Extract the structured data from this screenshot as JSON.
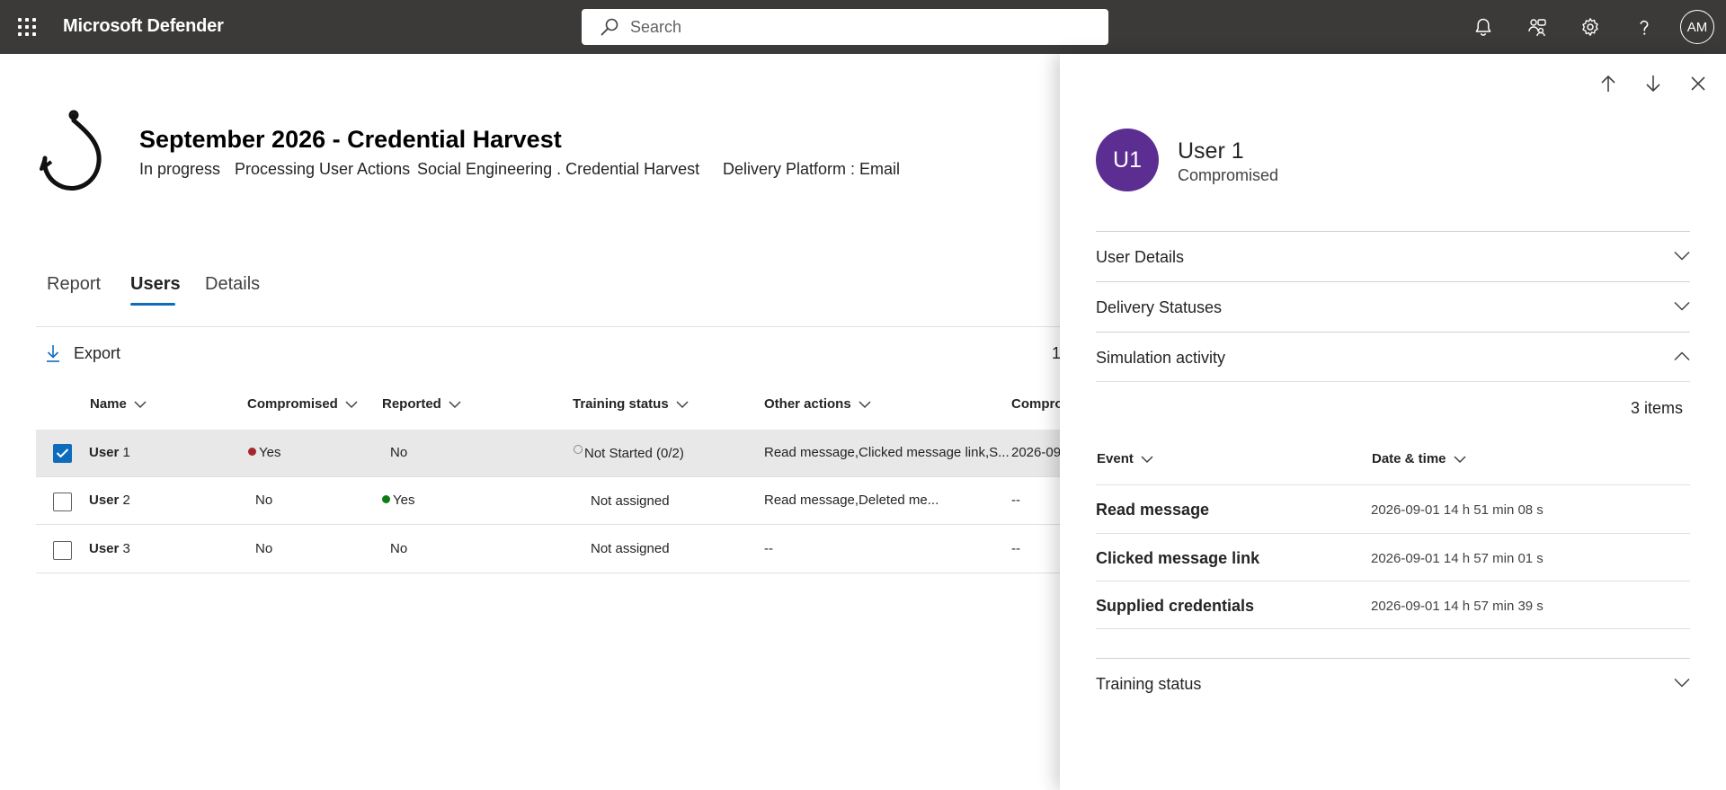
{
  "topbar": {
    "app_title": "Microsoft Defender",
    "search_placeholder": "Search",
    "avatar_initials": "AM",
    "icons": [
      "waffle-icon",
      "search-icon",
      "bell-icon",
      "community-icon",
      "gear-icon",
      "help-icon"
    ]
  },
  "simulation": {
    "title": "September 2026 - Credential Harvest",
    "status": "In progress",
    "phase": "Processing User Actions",
    "technique": "Social Engineering . Credential Harvest",
    "platform": "Delivery Platform : Email"
  },
  "tabs": [
    {
      "label": "Report",
      "active": false
    },
    {
      "label": "Users",
      "active": true
    },
    {
      "label": "Details",
      "active": false
    }
  ],
  "toolbar": {
    "export_label": "Export",
    "count_stub": "1"
  },
  "table": {
    "columns": [
      "Name",
      "Compromised",
      "Reported",
      "Training status",
      "Other actions",
      "Compro"
    ],
    "rows": [
      {
        "selected": true,
        "name_bold": "User",
        "name_num": " 1",
        "compromised": "Yes",
        "compromised_dot": "#a4262c",
        "reported": "No",
        "training": "Not Started (0/2)",
        "other": "Read message,Clicked message link,S...",
        "compromised_date": "2026-09"
      },
      {
        "selected": false,
        "name_bold": "User",
        "name_num": " 2",
        "compromised": "No",
        "reported": "Yes",
        "reported_dot": "#107c10",
        "training": "Not assigned",
        "other": "Read message,Deleted me...",
        "compromised_date": "--"
      },
      {
        "selected": false,
        "name_bold": "User",
        "name_num": " 3",
        "compromised": "No",
        "reported": "No",
        "training": "Not assigned",
        "other": "--",
        "compromised_date": "--"
      }
    ]
  },
  "panel": {
    "avatar_initials": "U1",
    "avatar_color": "#5c2e91",
    "user_name": "User 1",
    "user_status": "Compromised",
    "sections": {
      "user_details": "User Details",
      "delivery_statuses": "Delivery Statuses",
      "simulation_activity": "Simulation activity",
      "training_status": "Training status"
    },
    "items_count": "3 items",
    "activity_columns": [
      "Event",
      "Date & time"
    ],
    "activity": [
      {
        "event": "Read message",
        "datetime": "2026-09-01 14 h 51 min 08 s"
      },
      {
        "event": "Clicked message link",
        "datetime": "2026-09-01 14 h 57 min 01 s"
      },
      {
        "event": "Supplied credentials",
        "datetime": "2026-09-01 14 h 57 min 39 s"
      }
    ]
  },
  "colors": {
    "topbar": "#3b3a39",
    "accent": "#0f6cbd",
    "compromised": "#a4262c",
    "reported": "#107c10"
  }
}
